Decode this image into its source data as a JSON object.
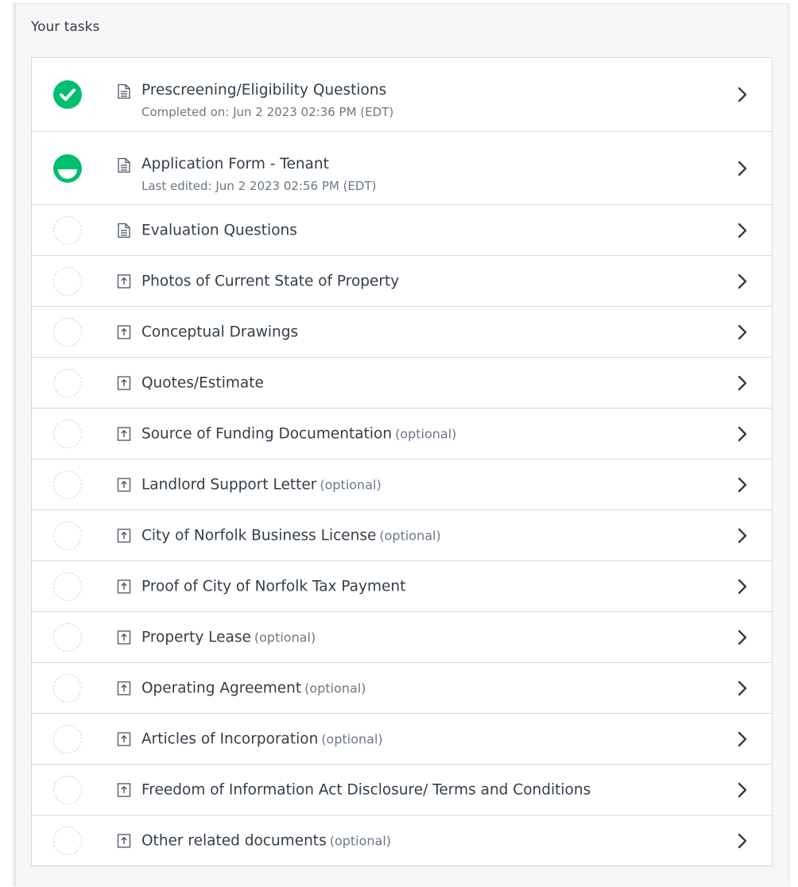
{
  "header": {
    "title": "Your tasks"
  },
  "colors": {
    "complete": "#00bf6f",
    "text": "#333e48",
    "muted": "#6b7885"
  },
  "tasks": [
    {
      "label": "Prescreening/Eligibility Questions",
      "optional": "",
      "detail": "Completed on: Jun 2 2023 02:36 PM (EDT)",
      "status": "complete",
      "type_icon": "document-icon"
    },
    {
      "label": "Application Form - Tenant",
      "optional": "",
      "detail": "Last edited: Jun 2 2023 02:56 PM (EDT)",
      "status": "in-progress",
      "type_icon": "document-icon"
    },
    {
      "label": "Evaluation Questions",
      "optional": "",
      "detail": "",
      "status": "not-started",
      "type_icon": "document-icon"
    },
    {
      "label": "Photos of Current State of Property",
      "optional": "",
      "detail": "",
      "status": "not-started",
      "type_icon": "upload-icon"
    },
    {
      "label": "Conceptual Drawings",
      "optional": "",
      "detail": "",
      "status": "not-started",
      "type_icon": "upload-icon"
    },
    {
      "label": "Quotes/Estimate",
      "optional": "",
      "detail": "",
      "status": "not-started",
      "type_icon": "upload-icon"
    },
    {
      "label": "Source of Funding Documentation",
      "optional": "(optional)",
      "detail": "",
      "status": "not-started",
      "type_icon": "upload-icon"
    },
    {
      "label": "Landlord Support Letter",
      "optional": "(optional)",
      "detail": "",
      "status": "not-started",
      "type_icon": "upload-icon"
    },
    {
      "label": "City of Norfolk Business License",
      "optional": "(optional)",
      "detail": "",
      "status": "not-started",
      "type_icon": "upload-icon"
    },
    {
      "label": "Proof of City of Norfolk Tax Payment",
      "optional": "",
      "detail": "",
      "status": "not-started",
      "type_icon": "upload-icon"
    },
    {
      "label": "Property Lease",
      "optional": "(optional)",
      "detail": "",
      "status": "not-started",
      "type_icon": "upload-icon"
    },
    {
      "label": "Operating Agreement",
      "optional": "(optional)",
      "detail": "",
      "status": "not-started",
      "type_icon": "upload-icon"
    },
    {
      "label": "Articles of Incorporation",
      "optional": "(optional)",
      "detail": "",
      "status": "not-started",
      "type_icon": "upload-icon"
    },
    {
      "label": "Freedom of Information Act Disclosure/ Terms and Conditions",
      "optional": "",
      "detail": "",
      "status": "not-started",
      "type_icon": "upload-icon"
    },
    {
      "label": "Other related documents",
      "optional": "(optional)",
      "detail": "",
      "status": "not-started",
      "type_icon": "upload-icon"
    }
  ]
}
